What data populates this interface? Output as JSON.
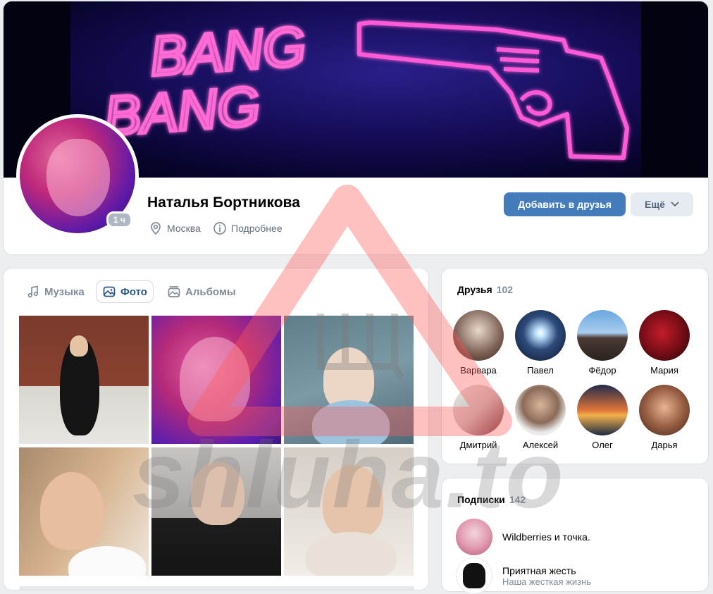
{
  "profile": {
    "cover_text_line1": "BANG",
    "cover_text_line2": "BANG",
    "name": "Наталья Бортникова",
    "online_badge": "1 ч",
    "location": "Москва",
    "more_info": "Подробнее",
    "add_friend": "Добавить в друзья",
    "more": "Ещё"
  },
  "media": {
    "tabs": [
      {
        "label": "Музыка",
        "icon": "music-note-icon"
      },
      {
        "label": "Фото",
        "icon": "image-icon",
        "selected": true
      },
      {
        "label": "Альбомы",
        "icon": "albums-icon"
      }
    ]
  },
  "friends": {
    "title": "Друзья",
    "count": "102",
    "items": [
      {
        "name": "Варвара"
      },
      {
        "name": "Павел"
      },
      {
        "name": "Фёдор"
      },
      {
        "name": "Мария"
      },
      {
        "name": "Дмитрий"
      },
      {
        "name": "Алексей"
      },
      {
        "name": "Олег"
      },
      {
        "name": "Дарья"
      }
    ]
  },
  "subscriptions": {
    "title": "Подписки",
    "count": "142",
    "items": [
      {
        "name": "Wildberries и точка.",
        "desc": ""
      },
      {
        "name": "Приятная жесть",
        "desc": "Наша жесткая жизнь"
      }
    ]
  },
  "watermark": {
    "text": "shluha.to"
  },
  "colors": {
    "accent": "#447bba",
    "link": "#2a5885",
    "background": "#edeef0"
  }
}
